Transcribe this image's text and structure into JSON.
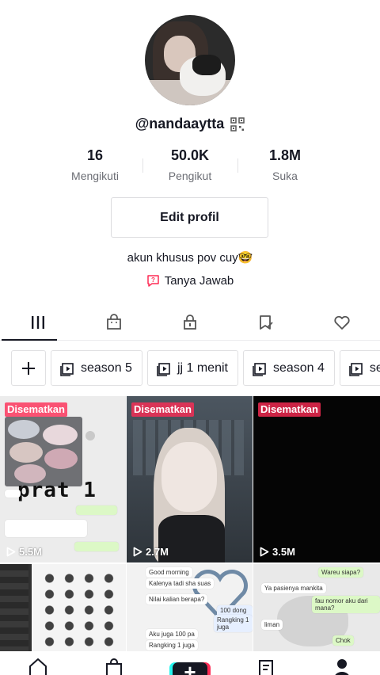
{
  "profile": {
    "username": "@nandaaytta",
    "bio": "akun khusus pov cuy🤓",
    "qa_label": "Tanya Jawab",
    "edit_button": "Edit profil"
  },
  "stats": [
    {
      "value": "16",
      "label": "Mengikuti"
    },
    {
      "value": "50.0K",
      "label": "Pengikut"
    },
    {
      "value": "1.8M",
      "label": "Suka"
    }
  ],
  "tabs": [
    {
      "name": "videos",
      "icon": "grid-icon",
      "active": true
    },
    {
      "name": "shop",
      "icon": "shopping-bag-icon"
    },
    {
      "name": "private",
      "icon": "lock-icon"
    },
    {
      "name": "saved",
      "icon": "bookmark-icon"
    },
    {
      "name": "liked",
      "icon": "heart-icon"
    }
  ],
  "playlists": [
    {
      "label": "season 5"
    },
    {
      "label": "jj 1 menit"
    },
    {
      "label": "season 4"
    },
    {
      "label": "se"
    }
  ],
  "videos": [
    {
      "pinned": "Disematkan",
      "views": "5.5M",
      "caption": "prat 1"
    },
    {
      "pinned": "Disematkan",
      "views": "2.7M"
    },
    {
      "pinned": "Disematkan",
      "views": "3.5M"
    },
    {
      "views": ""
    },
    {
      "views": "",
      "chat": [
        "Good morning",
        "Kalenya tadi sha suas",
        "Nilai kalian berapa?",
        "Aku juga 100 pa",
        "Rangking 1 juga",
        "100 dong pa",
        "Rangking 1 juga"
      ]
    },
    {
      "views": "",
      "chat": [
        "Wareu siapa?",
        "Ya pasienya mankita",
        "fau nomor aku dari mana?",
        "liman",
        "Chok"
      ]
    }
  ],
  "colors": {
    "accent": "#fe2c55",
    "teal": "#25f4ee",
    "text": "#161823",
    "muted": "#6b6d74"
  },
  "bottom_nav": [
    {
      "icon": "home-icon"
    },
    {
      "icon": "shop-icon"
    },
    {
      "icon": "create-plus-icon"
    },
    {
      "icon": "inbox-icon"
    },
    {
      "icon": "profile-icon"
    }
  ]
}
